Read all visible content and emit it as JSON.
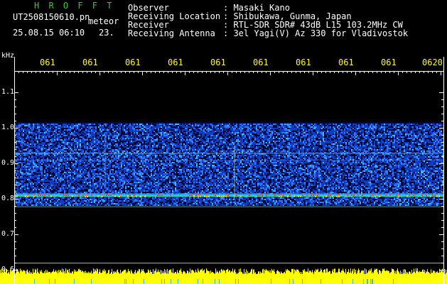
{
  "header": {
    "brand": "H R O F F T",
    "filename": "UT2508150610.pn",
    "event_type": "meteor",
    "datetime": "25.08.15 06:10",
    "count": "23.",
    "fields": [
      {
        "label": "Observer",
        "value": ": Masaki Kano"
      },
      {
        "label": "Receiving Location",
        "value": ": Shibukawa, Gunma, Japan"
      },
      {
        "label": "Receiver",
        "value": ": RTL-SDR SDR# 43dB L15 103.2MHz CW"
      },
      {
        "label": "Receiving Antenna",
        "value": ": 3el Yagi(V) Az 330 for Vladivostok"
      }
    ]
  },
  "colors": {
    "background": "#000000",
    "header_text": "#ffffff",
    "brand": "#33cc33",
    "time_ticks": "#ffff00",
    "axis": "#ffffff",
    "noise_bar": "#ffff00"
  },
  "time_axis": {
    "ticks": [
      "061",
      "061",
      "061",
      "061",
      "061",
      "061",
      "061",
      "061",
      "061",
      "0620"
    ]
  },
  "freq_axis": {
    "unit": "kHz",
    "labels": [
      "1.1",
      "1.0",
      "0.9",
      "0.8",
      "0.7",
      "0.6"
    ]
  },
  "chart_data": {
    "type": "heatmap",
    "xlabel": "",
    "ylabel": "kHz",
    "ylim": [
      0.6,
      1.1
    ],
    "x_tick_labels": [
      "061",
      "061",
      "061",
      "061",
      "061",
      "061",
      "061",
      "061",
      "061",
      "0620"
    ],
    "y_tick_labels": [
      "1.1",
      "1.0",
      "0.9",
      "0.8",
      "0.7",
      "0.6"
    ]
  }
}
